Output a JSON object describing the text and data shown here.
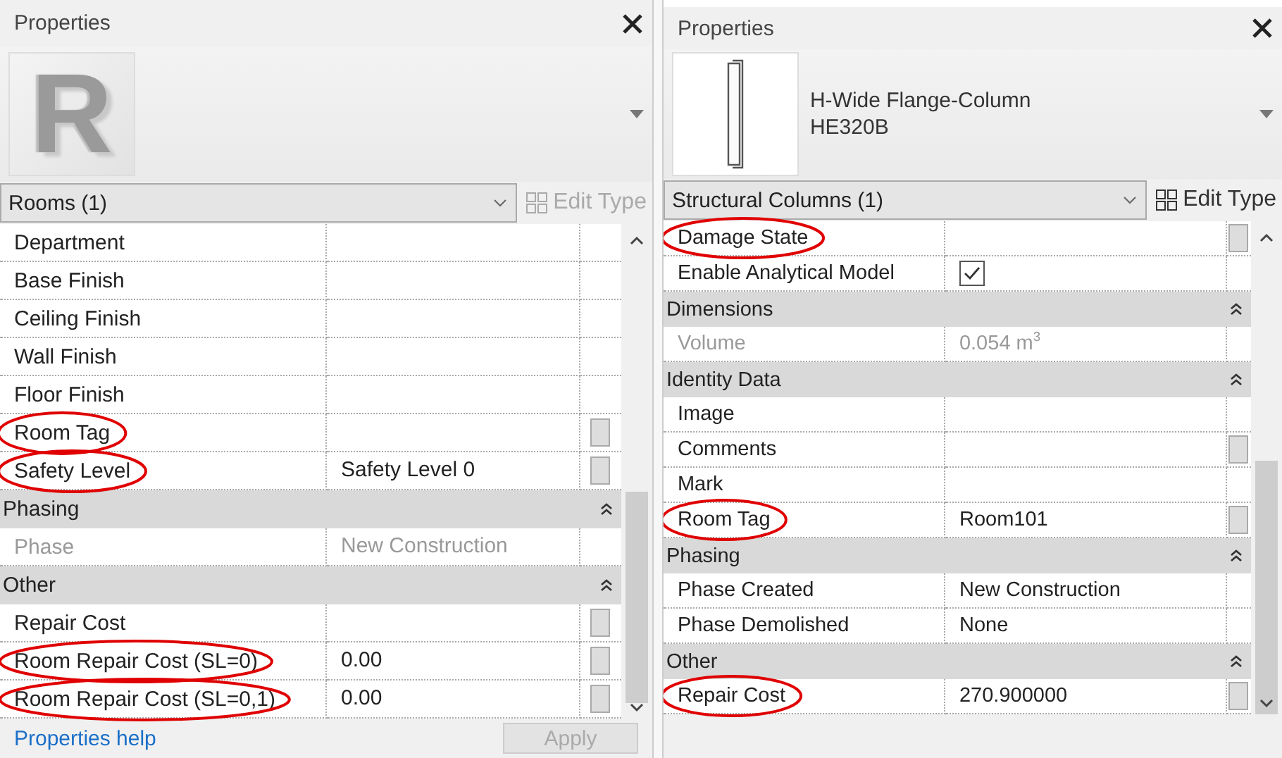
{
  "panels": [
    {
      "title": "Properties",
      "preview": {
        "kind": "logo",
        "logo_text": "R"
      },
      "selector": {
        "value": "Rooms (1)"
      },
      "edit_type": {
        "label": "Edit Type",
        "disabled": true
      },
      "rows": [
        {
          "kind": "text",
          "label": "Department",
          "value": "",
          "param_button": false,
          "disabled": false,
          "circled": false
        },
        {
          "kind": "text",
          "label": "Base Finish",
          "value": "",
          "param_button": false,
          "disabled": false,
          "circled": false
        },
        {
          "kind": "text",
          "label": "Ceiling Finish",
          "value": "",
          "param_button": false,
          "disabled": false,
          "circled": false
        },
        {
          "kind": "text",
          "label": "Wall Finish",
          "value": "",
          "param_button": false,
          "disabled": false,
          "circled": false
        },
        {
          "kind": "text",
          "label": "Floor Finish",
          "value": "",
          "param_button": false,
          "disabled": false,
          "circled": false
        },
        {
          "kind": "text",
          "label": "Room Tag",
          "value": "",
          "param_button": true,
          "disabled": false,
          "circled": true
        },
        {
          "kind": "text",
          "label": "Safety Level",
          "value": "Safety Level 0",
          "param_button": true,
          "disabled": false,
          "circled": true
        },
        {
          "kind": "header",
          "label": "Phasing",
          "expanded": true
        },
        {
          "kind": "text",
          "label": "Phase",
          "value": "New Construction",
          "param_button": false,
          "disabled": true,
          "circled": false
        },
        {
          "kind": "header",
          "label": "Other",
          "expanded": true
        },
        {
          "kind": "text",
          "label": "Repair Cost",
          "value": "",
          "param_button": true,
          "disabled": false,
          "circled": false
        },
        {
          "kind": "text",
          "label": "Room Repair Cost (SL=0)",
          "value": "0.00",
          "param_button": true,
          "disabled": false,
          "circled": true
        },
        {
          "kind": "text",
          "label": "Room Repair Cost (SL=0,1)",
          "value": "0.00",
          "param_button": true,
          "disabled": false,
          "circled": true
        }
      ],
      "footer": {
        "help_link": "Properties help",
        "apply": {
          "label": "Apply",
          "disabled": true
        }
      }
    },
    {
      "title": "Properties",
      "preview": {
        "kind": "column",
        "type_name": "H-Wide Flange-Column",
        "type_size": "HE320B"
      },
      "selector": {
        "value": "Structural Columns (1)"
      },
      "edit_type": {
        "label": "Edit Type",
        "disabled": false
      },
      "rows": [
        {
          "kind": "text",
          "label": "Damage State",
          "value": "",
          "param_button": true,
          "disabled": false,
          "circled": true
        },
        {
          "kind": "checkbox",
          "label": "Enable Analytical Model",
          "checked": true,
          "param_button": false,
          "disabled": false,
          "circled": false
        },
        {
          "kind": "header",
          "label": "Dimensions",
          "expanded": true
        },
        {
          "kind": "text",
          "label": "Volume",
          "value": "0.054 m$^{3}$",
          "param_button": false,
          "disabled": true,
          "circled": false
        },
        {
          "kind": "header",
          "label": "Identity Data",
          "expanded": true
        },
        {
          "kind": "text",
          "label": "Image",
          "value": "",
          "param_button": false,
          "disabled": false,
          "circled": false
        },
        {
          "kind": "text",
          "label": "Comments",
          "value": "",
          "param_button": true,
          "disabled": false,
          "circled": false
        },
        {
          "kind": "text",
          "label": "Mark",
          "value": "",
          "param_button": false,
          "disabled": false,
          "circled": false
        },
        {
          "kind": "text",
          "label": "Room Tag",
          "value": "Room101",
          "param_button": true,
          "disabled": false,
          "circled": true
        },
        {
          "kind": "header",
          "label": "Phasing",
          "expanded": true
        },
        {
          "kind": "text",
          "label": "Phase Created",
          "value": "New Construction",
          "param_button": false,
          "disabled": false,
          "circled": false
        },
        {
          "kind": "text",
          "label": "Phase Demolished",
          "value": "None",
          "param_button": false,
          "disabled": false,
          "circled": false
        },
        {
          "kind": "header",
          "label": "Other",
          "expanded": true
        },
        {
          "kind": "text",
          "label": "Repair Cost",
          "value": "270.900000",
          "param_button": true,
          "disabled": false,
          "circled": true
        }
      ]
    }
  ]
}
